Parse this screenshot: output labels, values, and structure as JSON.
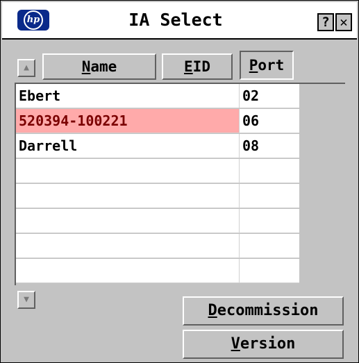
{
  "window": {
    "title": "IA Select",
    "logo_text": "hp",
    "help_label": "?",
    "close_label": "✕"
  },
  "toolbar": {
    "name_label": "Name",
    "eid_label": "EID",
    "port_label": "Port",
    "active_sort": "Port"
  },
  "list": {
    "rows": [
      {
        "name": "Ebert",
        "port": "02",
        "selected": false
      },
      {
        "name": "520394-100221",
        "port": "06",
        "selected": true
      },
      {
        "name": "Darrell",
        "port": "08",
        "selected": false
      },
      {
        "name": "",
        "port": "",
        "selected": false
      },
      {
        "name": "",
        "port": "",
        "selected": false
      },
      {
        "name": "",
        "port": "",
        "selected": false
      },
      {
        "name": "",
        "port": "",
        "selected": false
      },
      {
        "name": "",
        "port": "",
        "selected": false
      }
    ]
  },
  "actions": {
    "decommission_label": "Decommission",
    "version_label": "Version"
  },
  "icons": {
    "scroll_up": "triangle-up-icon",
    "scroll_down": "triangle-down-icon"
  },
  "colors": {
    "selection": "#ffaaaa",
    "logo": "#0a2a8a",
    "window": "#c3c3c3"
  }
}
